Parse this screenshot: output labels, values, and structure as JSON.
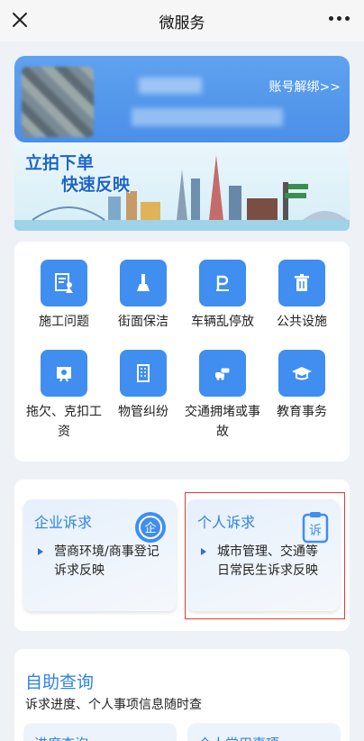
{
  "header": {
    "title": "微服务"
  },
  "profile": {
    "unbind_label": "账号解绑>>"
  },
  "banner": {
    "slogan_line1": "立拍下单",
    "slogan_line2": "快速反映"
  },
  "categories": [
    {
      "label": "施工问题",
      "icon": "construction-worker-icon"
    },
    {
      "label": "街面保洁",
      "icon": "broom-icon"
    },
    {
      "label": "车辆乱停放",
      "icon": "parking-icon"
    },
    {
      "label": "公共设施",
      "icon": "trash-bin-icon"
    },
    {
      "label": "拖欠、克扣工资",
      "icon": "wage-certificate-icon"
    },
    {
      "label": "物管纠纷",
      "icon": "building-icon"
    },
    {
      "label": "交通拥堵或事故",
      "icon": "car-collision-icon"
    },
    {
      "label": "教育事务",
      "icon": "graduation-cap-icon"
    }
  ],
  "appeals": {
    "enterprise": {
      "title": "企业诉求",
      "desc": "营商环境/商事登记诉求反映",
      "icon": "enterprise-badge-icon"
    },
    "personal": {
      "title": "个人诉求",
      "desc": "城市管理、交通等日常民生诉求反映",
      "icon": "clipboard-appeal-icon"
    }
  },
  "self_service": {
    "title": "自助查询",
    "subtitle": "诉求进度、个人事项信息随时查",
    "items": [
      "进度查询",
      "个人常用事项"
    ]
  },
  "colors": {
    "accent": "#3f8ef0",
    "highlight": "#e03a3a",
    "title_blue": "#2f84e2"
  }
}
